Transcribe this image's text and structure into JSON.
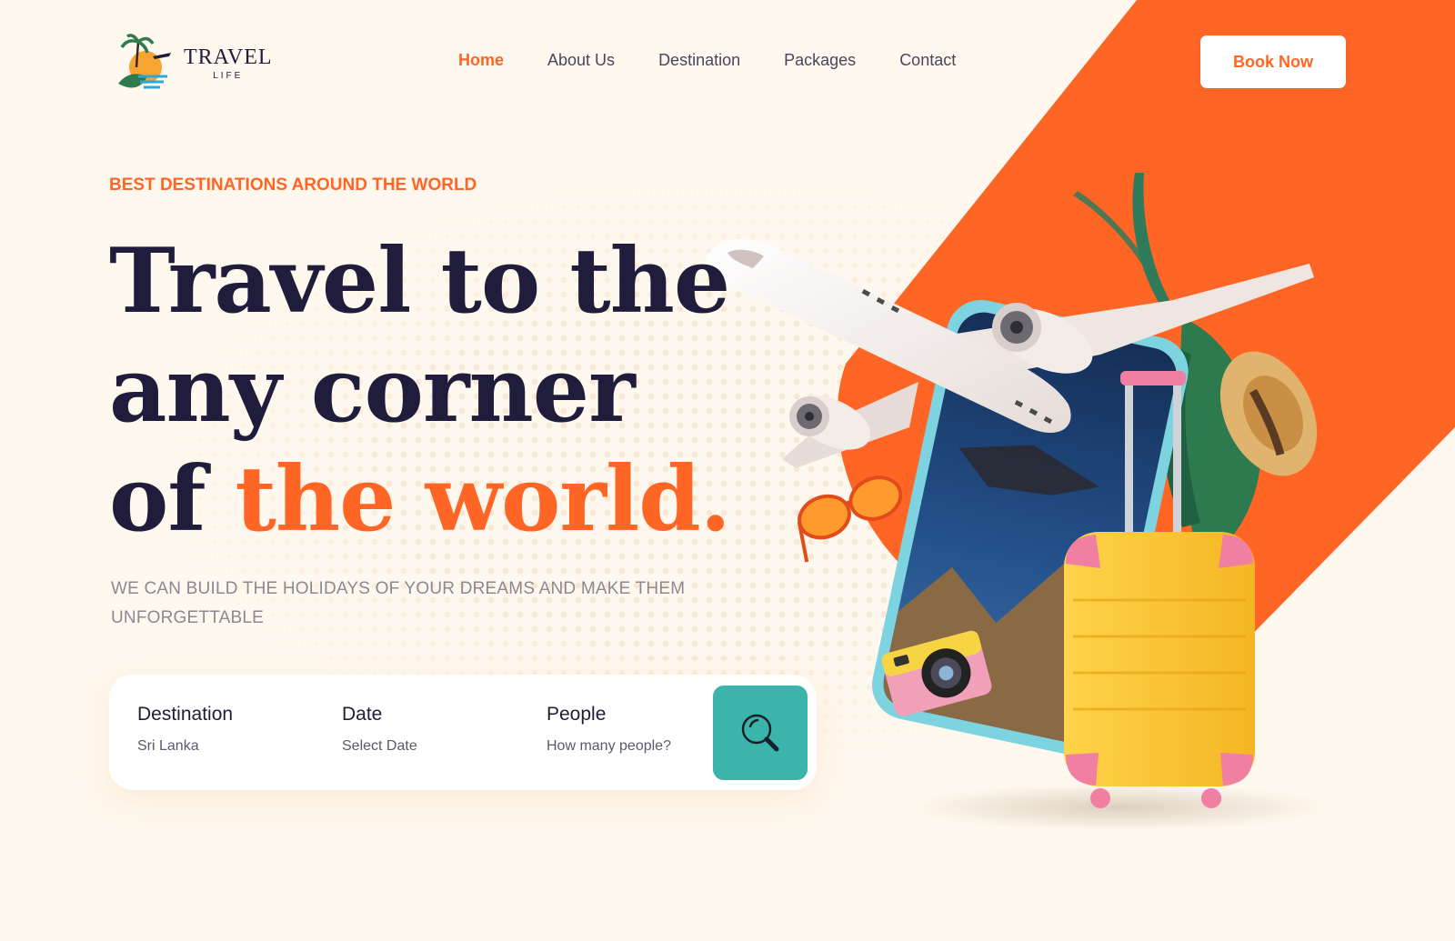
{
  "brand": {
    "name": "TRAVEL",
    "tagline": "LIFE"
  },
  "nav": {
    "items": [
      {
        "label": "Home",
        "active": true
      },
      {
        "label": "About Us"
      },
      {
        "label": "Destination"
      },
      {
        "label": "Packages"
      },
      {
        "label": "Contact"
      }
    ],
    "cta_label": "Book Now"
  },
  "hero": {
    "eyebrow": "BEST DESTINATIONS AROUND THE WORLD",
    "headline_line1": "Travel to the",
    "headline_line2": "any corner",
    "headline_line3_prefix": "of ",
    "headline_line3_accent": "the world.",
    "subtext": "WE CAN BUILD THE HOLIDAYS OF YOUR DREAMS AND MAKE THEM UNFORGETTABLE"
  },
  "search": {
    "destination": {
      "label": "Destination",
      "value": "Sri Lanka"
    },
    "date": {
      "label": "Date",
      "value": "Select Date"
    },
    "people": {
      "label": "People",
      "value": "How many people?"
    },
    "button_icon": "search-icon"
  },
  "colors": {
    "accent": "#ff6626",
    "background": "#fff8ee",
    "heading": "#1f1d3b",
    "search_button": "#3bb4ab",
    "suitcase": "#ffc93a"
  }
}
